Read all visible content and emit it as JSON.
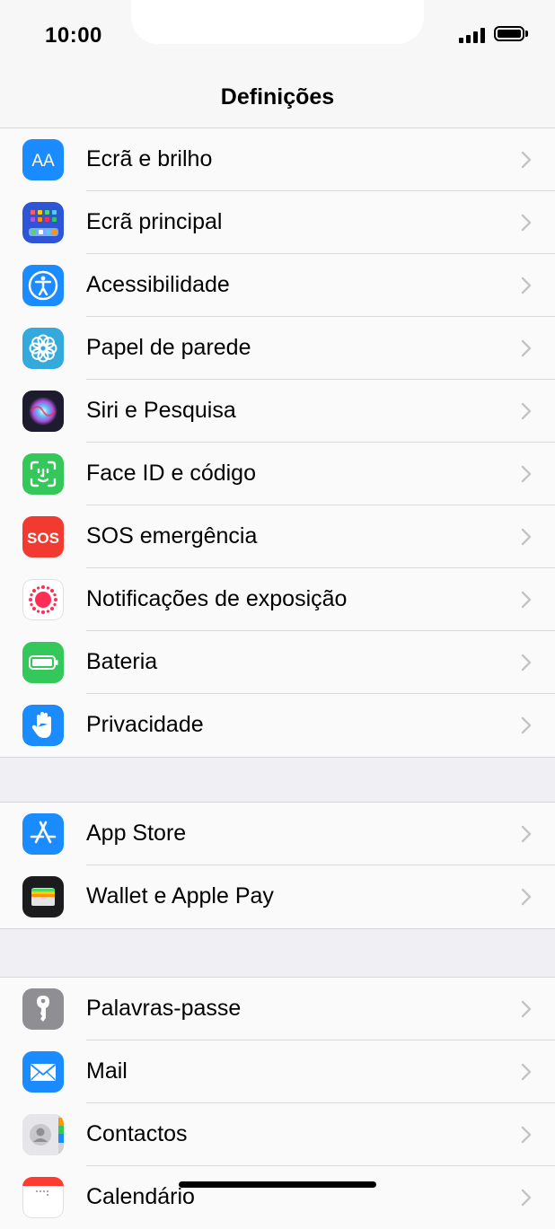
{
  "status_bar": {
    "time": "10:00"
  },
  "nav": {
    "title": "Definições"
  },
  "groups": [
    {
      "items": [
        {
          "label": "Ecrã e brilho",
          "icon": "display-brightness-icon",
          "color": "#1a8cff"
        },
        {
          "label": "Ecrã principal",
          "icon": "home-screen-icon",
          "color": "#2c55d8"
        },
        {
          "label": "Acessibilidade",
          "icon": "accessibility-icon",
          "color": "#1a8cff"
        },
        {
          "label": "Papel de parede",
          "icon": "wallpaper-flower-icon",
          "color": "#34aadc"
        },
        {
          "label": "Siri e Pesquisa",
          "icon": "siri-icon",
          "color": "#1c1c2e"
        },
        {
          "label": "Face ID e código",
          "icon": "face-id-icon",
          "color": "#34c759"
        },
        {
          "label": "SOS emergência",
          "icon": "sos-icon",
          "icon_text": "SOS",
          "color": "#f23b30"
        },
        {
          "label": "Notificações de exposição",
          "icon": "exposure-notifications-icon",
          "color": "#ff2d55"
        },
        {
          "label": "Bateria",
          "icon": "battery-icon",
          "color": "#34c759"
        },
        {
          "label": "Privacidade",
          "icon": "privacy-hand-icon",
          "color": "#1a8cff"
        }
      ]
    },
    {
      "items": [
        {
          "label": "App Store",
          "icon": "app-store-icon",
          "color": "#1a8cff"
        },
        {
          "label": "Wallet e Apple Pay",
          "icon": "wallet-icon",
          "color": "#1c1c1e"
        }
      ]
    },
    {
      "items": [
        {
          "label": "Palavras-passe",
          "icon": "key-icon",
          "color": "#8e8e93"
        },
        {
          "label": "Mail",
          "icon": "mail-icon",
          "color": "#1a8cff"
        },
        {
          "label": "Contactos",
          "icon": "contacts-icon",
          "color": "#c7c7cc"
        },
        {
          "label": "Calendário",
          "icon": "calendar-icon",
          "color": "#ffffff"
        }
      ]
    }
  ]
}
